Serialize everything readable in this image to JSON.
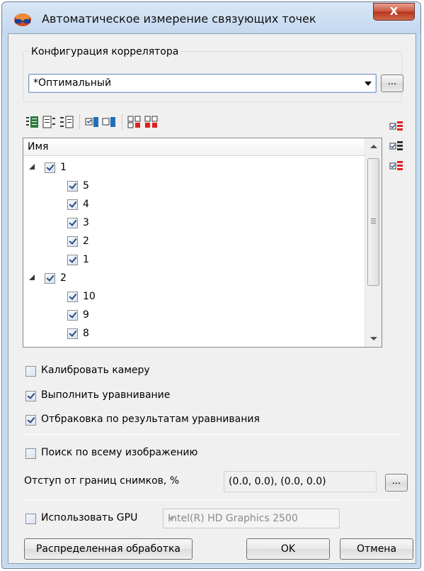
{
  "window": {
    "title": "Автоматическое измерение связующих точек",
    "close_label": "X"
  },
  "correlator": {
    "group_title": "Конфигурация коррелятора",
    "selected": "*Оптимальный",
    "browse_label": "..."
  },
  "toolbar": {
    "icons": [
      "expand-all-icon",
      "collapse-icon",
      "tree-levels-icon",
      "check-selected-icon",
      "uncheck-selected-icon",
      "check-all-icon",
      "uncheck-all-icon"
    ]
  },
  "side_buttons": {
    "icons": [
      "check-all-icon",
      "check-selected-icon",
      "uncheck-all-icon"
    ]
  },
  "tree": {
    "header": "Имя",
    "rows": [
      {
        "label": "1",
        "level": 0,
        "checked": true,
        "expanded": true
      },
      {
        "label": "5",
        "level": 1,
        "checked": true
      },
      {
        "label": "4",
        "level": 1,
        "checked": true
      },
      {
        "label": "3",
        "level": 1,
        "checked": true
      },
      {
        "label": "2",
        "level": 1,
        "checked": true
      },
      {
        "label": "1",
        "level": 1,
        "checked": true
      },
      {
        "label": "2",
        "level": 0,
        "checked": true,
        "expanded": true
      },
      {
        "label": "10",
        "level": 1,
        "checked": true
      },
      {
        "label": "9",
        "level": 1,
        "checked": true
      },
      {
        "label": "8",
        "level": 1,
        "checked": true
      }
    ]
  },
  "options": {
    "calibrate_camera": {
      "label": "Калибровать камеру",
      "checked": false
    },
    "adjustment": {
      "label": "Выполнить уравнивание",
      "checked": true
    },
    "rejection": {
      "label": "Отбраковка по результатам уравнивания",
      "checked": true
    },
    "full_search": {
      "label": "Поиск по всему изображению",
      "checked": false
    }
  },
  "margin": {
    "label": "Отступ от границ снимков, %",
    "value": "(0.0, 0.0), (0.0, 0.0)",
    "browse_label": "..."
  },
  "gpu": {
    "label": "Использовать GPU",
    "checked": false,
    "device": "Intel(R) HD Graphics 2500"
  },
  "buttons": {
    "distributed": "Распределенная обработка",
    "ok": "OK",
    "cancel": "Отмена"
  }
}
